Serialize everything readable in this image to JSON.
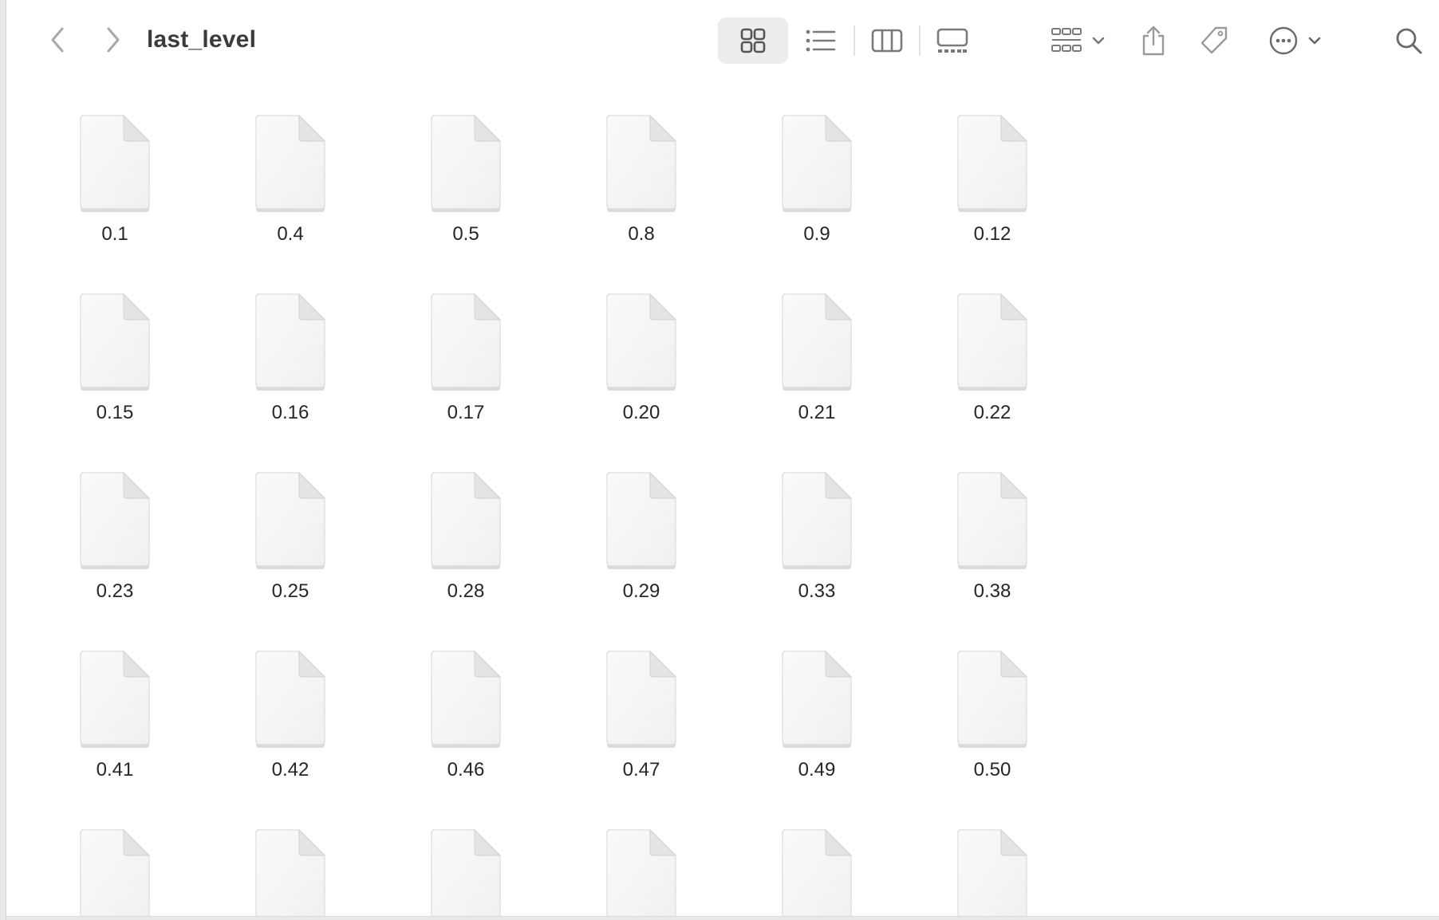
{
  "window": {
    "title": "last_level"
  },
  "toolbar": {
    "back_icon": "chevron-left-icon",
    "forward_icon": "chevron-right-icon",
    "view_modes": [
      "icons",
      "list",
      "columns",
      "gallery"
    ],
    "active_view": "icons",
    "group_icon": "group-by-icon",
    "share_icon": "share-icon",
    "tag_icon": "tag-icon",
    "more_icon": "ellipsis-circle-icon",
    "search_icon": "search-icon"
  },
  "files": [
    {
      "name": "0.1"
    },
    {
      "name": "0.4"
    },
    {
      "name": "0.5"
    },
    {
      "name": "0.8"
    },
    {
      "name": "0.9"
    },
    {
      "name": "0.12"
    },
    {
      "name": "0.15"
    },
    {
      "name": "0.16"
    },
    {
      "name": "0.17"
    },
    {
      "name": "0.20"
    },
    {
      "name": "0.21"
    },
    {
      "name": "0.22"
    },
    {
      "name": "0.23"
    },
    {
      "name": "0.25"
    },
    {
      "name": "0.28"
    },
    {
      "name": "0.29"
    },
    {
      "name": "0.33"
    },
    {
      "name": "0.38"
    },
    {
      "name": "0.41"
    },
    {
      "name": "0.42"
    },
    {
      "name": "0.46"
    },
    {
      "name": "0.47"
    },
    {
      "name": "0.49"
    },
    {
      "name": "0.50"
    },
    {
      "name": ""
    },
    {
      "name": ""
    },
    {
      "name": ""
    },
    {
      "name": ""
    },
    {
      "name": ""
    },
    {
      "name": ""
    }
  ],
  "colors": {
    "accent_selected_bg": "#ececec",
    "icon_gray": "#8a8a8a",
    "label_text": "#262626"
  }
}
